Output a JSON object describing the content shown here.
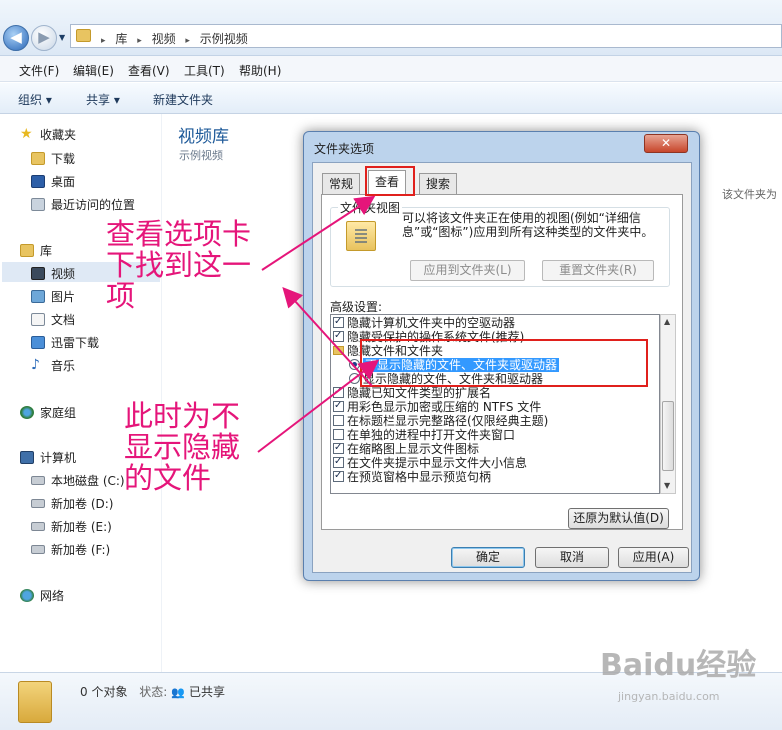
{
  "address": {
    "crumbs": [
      "库",
      "视频",
      "示例视频"
    ]
  },
  "menu": [
    "文件(F)",
    "编辑(E)",
    "查看(V)",
    "工具(T)",
    "帮助(H)"
  ],
  "toolbar": {
    "organize": "组织 ▾",
    "share": "共享 ▾",
    "new_folder": "新建文件夹"
  },
  "nav": {
    "favorites": "收藏夹",
    "downloads": "下载",
    "desktop": "桌面",
    "recent": "最近访问的位置",
    "libraries": "库",
    "videos": "视频",
    "pictures": "图片",
    "documents": "文档",
    "thunder": "迅雷下载",
    "music": "音乐",
    "homegroup": "家庭组",
    "computer": "计算机",
    "drive_c": "本地磁盘 (C:)",
    "drive_d": "新加卷 (D:)",
    "drive_e": "新加卷 (E:)",
    "drive_f": "新加卷 (F:)",
    "network": "网络"
  },
  "content": {
    "title": "视频库",
    "subtitle": "示例视频",
    "arrange_hint": "该文件夹为"
  },
  "status": {
    "count": "0 个对象",
    "state_label": "状态:",
    "state_value": "已共享"
  },
  "dialog": {
    "title": "文件夹选项",
    "close": "✕",
    "tabs": [
      "常规",
      "查看",
      "搜索"
    ],
    "active_tab": "查看",
    "folder_views": {
      "title": "文件夹视图",
      "desc": "可以将该文件夹正在使用的视图(例如“详细信息”或“图标”)应用到所有这种类型的文件夹中。",
      "apply": "应用到文件夹(L)",
      "reset": "重置文件夹(R)"
    },
    "advanced_label": "高级设置:",
    "settings": [
      {
        "text": "隐藏计算机文件夹中的空驱动器",
        "kind": "check",
        "checked": true
      },
      {
        "text": "隐藏受保护的操作系统文件(推荐)",
        "kind": "check",
        "checked": true
      },
      {
        "text": "隐藏文件和文件夹",
        "kind": "folder",
        "checked": false
      },
      {
        "text": "不显示隐藏的文件、文件夹或驱动器",
        "kind": "radio",
        "checked": true
      },
      {
        "text": "显示隐藏的文件、文件夹和驱动器",
        "kind": "radio",
        "checked": false
      },
      {
        "text": "隐藏已知文件类型的扩展名",
        "kind": "check",
        "checked": true
      },
      {
        "text": "用彩色显示加密或压缩的 NTFS 文件",
        "kind": "check",
        "checked": true
      },
      {
        "text": "在标题栏显示完整路径(仅限经典主题)",
        "kind": "check",
        "checked": false
      },
      {
        "text": "在单独的进程中打开文件夹窗口",
        "kind": "check",
        "checked": false
      },
      {
        "text": "在缩略图上显示文件图标",
        "kind": "check",
        "checked": true
      },
      {
        "text": "在文件夹提示中显示文件大小信息",
        "kind": "check",
        "checked": true
      },
      {
        "text": "在预览窗格中显示预览句柄",
        "kind": "check",
        "checked": true
      }
    ],
    "restore_defaults": "还原为默认值(D)",
    "ok": "确定",
    "cancel": "取消",
    "apply": "应用(A)"
  },
  "annotations": {
    "note1": "查看选项卡下找到这一项",
    "note2": "此时为不显示隐藏的文件",
    "color": "#e5157a"
  },
  "watermark": {
    "main": "Baidu经验",
    "sub": "jingyan.baidu.com"
  }
}
